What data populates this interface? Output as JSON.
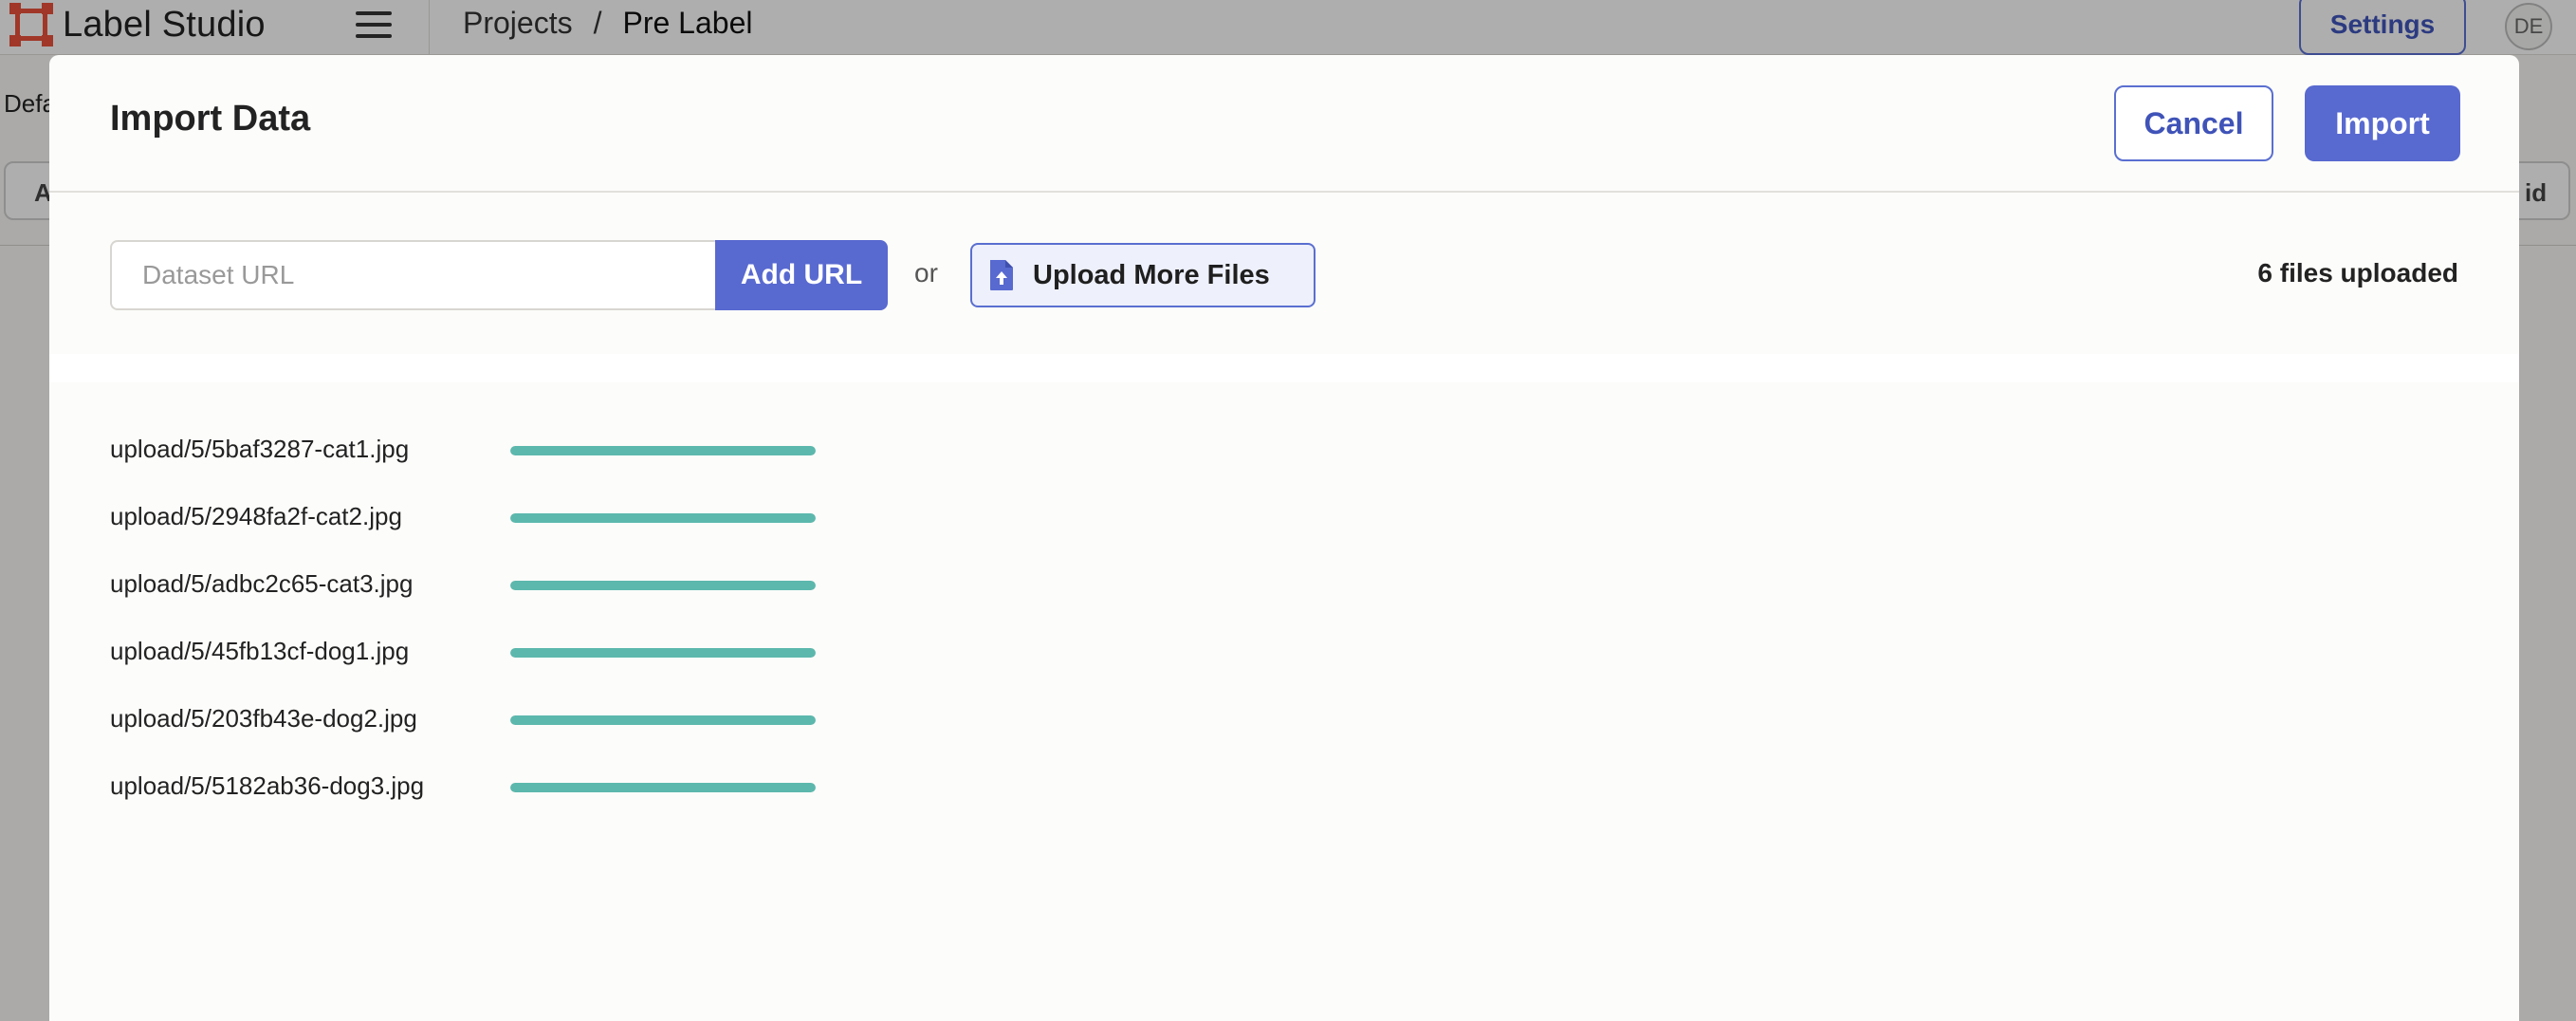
{
  "app": {
    "title": "Label Studio"
  },
  "breadcrumb": {
    "projects": "Projects",
    "separator": "/",
    "current": "Pre Label"
  },
  "header": {
    "settings_label": "Settings",
    "avatar_initials": "DE"
  },
  "background": {
    "subbar_text": "Defa",
    "left_button_text": "A",
    "right_button_text": "id"
  },
  "modal": {
    "title": "Import Data",
    "cancel_label": "Cancel",
    "import_label": "Import",
    "url_placeholder": "Dataset URL",
    "url_value": "",
    "add_url_label": "Add URL",
    "or_text": "or",
    "upload_label": "Upload More Files",
    "files_uploaded_text": "6 files uploaded"
  },
  "files": [
    {
      "name": "upload/5/5baf3287-cat1.jpg",
      "progress": 1.0
    },
    {
      "name": "upload/5/2948fa2f-cat2.jpg",
      "progress": 1.0
    },
    {
      "name": "upload/5/adbc2c65-cat3.jpg",
      "progress": 1.0
    },
    {
      "name": "upload/5/45fb13cf-dog1.jpg",
      "progress": 1.0
    },
    {
      "name": "upload/5/203fb43e-dog2.jpg",
      "progress": 1.0
    },
    {
      "name": "upload/5/5182ab36-dog3.jpg",
      "progress": 1.0
    }
  ],
  "colors": {
    "accent": "#5869d0",
    "progress": "#5cb8ad",
    "logo": "#e5503a"
  },
  "icons": {
    "menu": "hamburger-icon",
    "upload": "file-upload-icon",
    "logo": "label-studio-logo-icon"
  }
}
